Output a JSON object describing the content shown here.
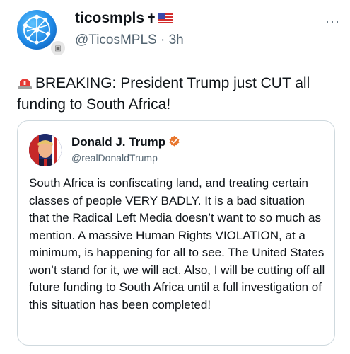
{
  "post": {
    "author_name": "ticosmpls",
    "name_emoji": "✝",
    "handle": "@TicosMPLS",
    "separator": "·",
    "time": "3h",
    "more": "···",
    "text": "BREAKING: President Trump just CUT all funding to South Africa!",
    "icons": {
      "avatar": "network-globe-logo",
      "badge": "affiliate-badge-icon",
      "siren": "rotating-light-icon",
      "flag": "us-flag-icon",
      "more": "more-options-icon"
    }
  },
  "quote": {
    "author_name": "Donald J. Trump",
    "handle": "@realDonaldTrump",
    "verified_icon": "verified-check-icon",
    "body": "South Africa is confiscating land, and treating certain classes of people VERY BADLY. It is a bad situation that the Radical Left Media doesn’t want to so much as mention. A massive Human Rights VIOLATION, at a minimum, is happening for all to see. The United States won’t stand for it, we will act. Also, I will be cutting off all future funding to South Africa until a full investigation of this situation has been completed!"
  },
  "colors": {
    "text": "#0f1419",
    "muted": "#536471",
    "border": "#cfd9de",
    "verified_orange": "#e8762d",
    "siren_red": "#e53935"
  }
}
